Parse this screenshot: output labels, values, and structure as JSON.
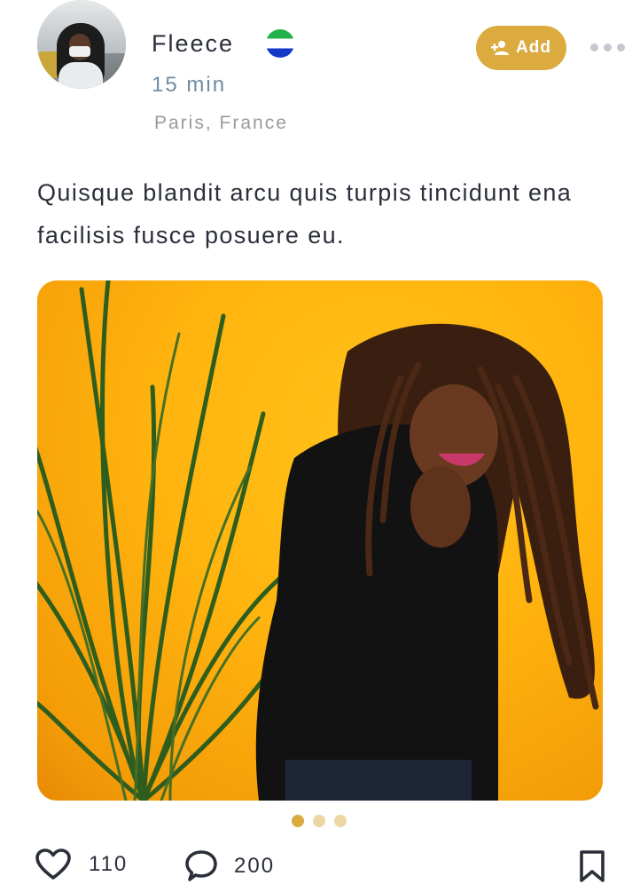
{
  "post": {
    "author_name": "Fleece",
    "time": "15 min",
    "location": "Paris, France",
    "flag_colors": [
      "#21b24a",
      "#ffffff",
      "#1438c8"
    ],
    "add_label": "Add",
    "caption": "Quisque blandit arcu quis turpis tincidunt ena facilisis fusce posuere eu.",
    "carousel": {
      "total": 3,
      "active": 0
    },
    "likes": "110",
    "comments": "200"
  },
  "colors": {
    "accent": "#dbab3f",
    "dot_inactive": "#ecd6a4",
    "text": "#2b2f3a",
    "time": "#6e8ca3",
    "muted": "#9a9a9a"
  },
  "icons": {
    "add_user": "add-user-icon",
    "more": "more-dots-icon",
    "like": "heart-icon",
    "comment": "comment-icon",
    "bookmark": "bookmark-icon"
  }
}
